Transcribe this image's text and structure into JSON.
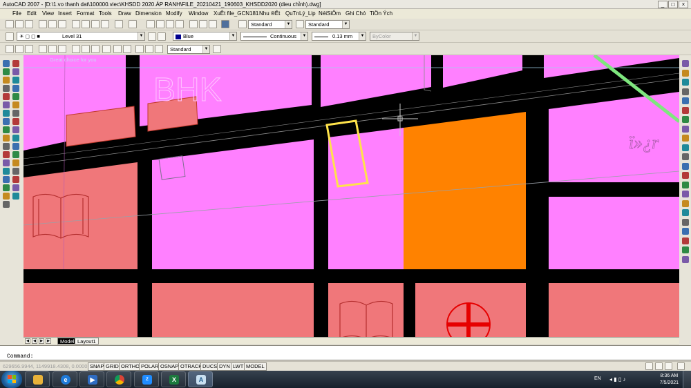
{
  "window": {
    "title": "AutoCAD 2007 - [D:\\1.vo thanh dat\\100000.viec\\KHSDD 2020.ÁP RANH\\FILE_20210421_190603_KHSDD2020 (dieu chỉnh).dwg]",
    "controls": [
      "_",
      "□",
      "×"
    ]
  },
  "menu": [
    "File",
    "Edit",
    "View",
    "Insert",
    "Format",
    "Tools",
    "Draw",
    "Dimension",
    "Modify",
    "Window",
    "XuÊt file_GCN181",
    "Nhu ®Êt",
    "QuTnLý_Lip",
    "NéiSiÔm",
    "Ghi Chó",
    "TiÖn Ých"
  ],
  "toolbar_styles": {
    "text_style": "Standard",
    "dim_style": "Standard"
  },
  "layers_toolbar": {
    "layer": "Level 31",
    "color": "Blue",
    "linetype": "Continuous",
    "lineweight": "0.13 mm",
    "plotstyle": "ByColor"
  },
  "dim_toolbar": {
    "style": "Standard"
  },
  "canvas": {
    "watermark": "Great choice for you",
    "label_bhk": "BHK",
    "label_cursive": "ï»¿r"
  },
  "tabs": [
    "Model",
    "Layout1"
  ],
  "active_tab": "Model",
  "command": {
    "label": "Command:"
  },
  "status": {
    "coords": "629656.9944, 1149918.4308, 0.0000",
    "toggles": [
      "SNAP",
      "GRID",
      "ORTHO",
      "POLAR",
      "OSNAP",
      "OTRACK",
      "DUCS",
      "DYN",
      "LWT",
      "MODEL"
    ]
  },
  "taskbar": {
    "apps": [
      "explorer-icon",
      "ie-icon",
      "media-player-icon",
      "chrome-icon",
      "zalo-icon",
      "excel-icon",
      "autocad-icon"
    ],
    "language": "EN",
    "time": "8:36 AM",
    "date": "7/5/2021"
  },
  "colors": {
    "road": "#000000",
    "residential": "#ff80ff",
    "commercial": "#f0777a",
    "public": "#ff8200",
    "selection": "#ffe34a",
    "transmission_line": "#7ee67e",
    "medical": "#e60000"
  }
}
